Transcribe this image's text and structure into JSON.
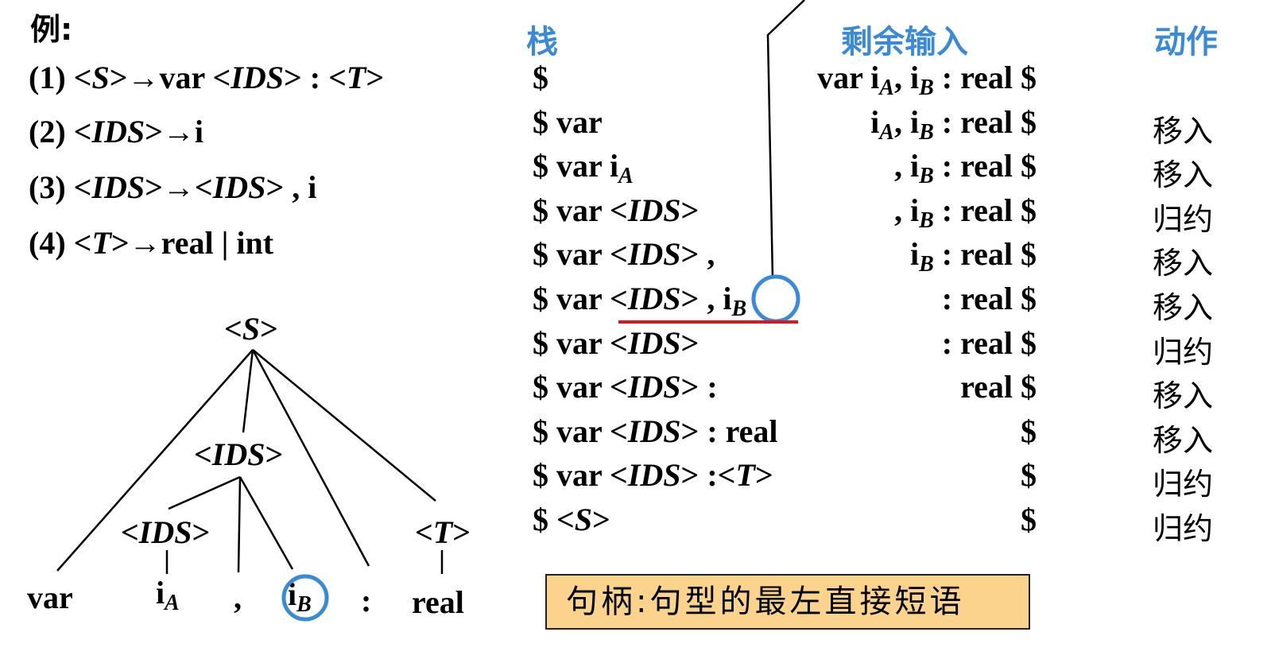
{
  "example_label": "例:",
  "productions": [
    {
      "num": "(1)",
      "segs": [
        [
          "t",
          "<"
        ],
        [
          "i",
          "S"
        ],
        [
          "t",
          ">→var <"
        ],
        [
          "i",
          "IDS"
        ],
        [
          "t",
          "> : <"
        ],
        [
          "i",
          "T"
        ],
        [
          "t",
          ">"
        ]
      ]
    },
    {
      "num": "(2)",
      "segs": [
        [
          "t",
          "<"
        ],
        [
          "i",
          "IDS"
        ],
        [
          "t",
          ">→i"
        ]
      ]
    },
    {
      "num": "(3)",
      "segs": [
        [
          "t",
          "<"
        ],
        [
          "i",
          "IDS"
        ],
        [
          "t",
          ">→<"
        ],
        [
          "i",
          "IDS"
        ],
        [
          "t",
          "> , i"
        ]
      ]
    },
    {
      "num": "(4)",
      "segs": [
        [
          "t",
          "<"
        ],
        [
          "i",
          "T"
        ],
        [
          "t",
          ">→real | int"
        ]
      ]
    }
  ],
  "table": {
    "headers": {
      "stack": "栈",
      "input": "剩余输入",
      "action": "动作"
    },
    "rows": [
      {
        "stack": [
          [
            "t",
            "$"
          ]
        ],
        "input": [
          [
            "t",
            "var i"
          ],
          [
            "s",
            "A"
          ],
          [
            "t",
            ", i"
          ],
          [
            "s",
            "B"
          ],
          [
            "t",
            " : real $"
          ]
        ],
        "action": ""
      },
      {
        "stack": [
          [
            "t",
            "$ var"
          ]
        ],
        "input": [
          [
            "t",
            "i"
          ],
          [
            "s",
            "A"
          ],
          [
            "t",
            ", i"
          ],
          [
            "s",
            "B"
          ],
          [
            "t",
            " : real $"
          ]
        ],
        "action": "移入"
      },
      {
        "stack": [
          [
            "t",
            "$ var i"
          ],
          [
            "s",
            "A"
          ]
        ],
        "input": [
          [
            "t",
            ", i"
          ],
          [
            "s",
            "B"
          ],
          [
            "t",
            " : real $"
          ]
        ],
        "action": "移入"
      },
      {
        "stack": [
          [
            "t",
            "$ var <"
          ],
          [
            "i",
            "IDS"
          ],
          [
            "t",
            ">"
          ]
        ],
        "input": [
          [
            "t",
            ", i"
          ],
          [
            "s",
            "B"
          ],
          [
            "t",
            " : real $"
          ]
        ],
        "action": "归约"
      },
      {
        "stack": [
          [
            "t",
            "$ var <"
          ],
          [
            "i",
            "IDS"
          ],
          [
            "t",
            "> ,"
          ]
        ],
        "input": [
          [
            "t",
            "i"
          ],
          [
            "s",
            "B"
          ],
          [
            "t",
            " : real $"
          ]
        ],
        "action": "移入"
      },
      {
        "stack": [
          [
            "t",
            "$ var <"
          ],
          [
            "i",
            "IDS"
          ],
          [
            "t",
            "> , i"
          ],
          [
            "s",
            "B"
          ]
        ],
        "input": [
          [
            "t",
            ": real $"
          ]
        ],
        "action": "移入"
      },
      {
        "stack": [
          [
            "t",
            "$ var <"
          ],
          [
            "i",
            "IDS"
          ],
          [
            "t",
            ">"
          ]
        ],
        "input": [
          [
            "t",
            ": real $"
          ]
        ],
        "action": "归约"
      },
      {
        "stack": [
          [
            "t",
            "$ var <"
          ],
          [
            "i",
            "IDS"
          ],
          [
            "t",
            "> :"
          ]
        ],
        "input": [
          [
            "t",
            "real $"
          ]
        ],
        "action": "移入"
      },
      {
        "stack": [
          [
            "t",
            "$ var <"
          ],
          [
            "i",
            "IDS"
          ],
          [
            "t",
            "> : real"
          ]
        ],
        "input": [
          [
            "t",
            "$"
          ]
        ],
        "action": "移入"
      },
      {
        "stack": [
          [
            "t",
            "$ var <"
          ],
          [
            "i",
            "IDS"
          ],
          [
            "t",
            "> :<"
          ],
          [
            "i",
            "T"
          ],
          [
            "t",
            ">"
          ]
        ],
        "input": [
          [
            "t",
            "$"
          ]
        ],
        "action": "归约"
      },
      {
        "stack": [
          [
            "t",
            "$ <"
          ],
          [
            "i",
            "S"
          ],
          [
            "t",
            ">"
          ]
        ],
        "input": [
          [
            "t",
            "$"
          ]
        ],
        "action": "归约"
      }
    ]
  },
  "tree": {
    "root": [
      [
        "t",
        "<"
      ],
      [
        "i",
        "S"
      ],
      [
        "t",
        ">"
      ]
    ],
    "ids_node": [
      [
        "t",
        "<"
      ],
      [
        "i",
        "IDS"
      ],
      [
        "t",
        ">"
      ]
    ],
    "ids_child": [
      [
        "t",
        "<"
      ],
      [
        "i",
        "IDS"
      ],
      [
        "t",
        ">"
      ]
    ],
    "t_node": [
      [
        "t",
        "<"
      ],
      [
        "i",
        "T"
      ],
      [
        "t",
        ">"
      ]
    ],
    "leaves": {
      "var": [
        [
          "t",
          "var"
        ]
      ],
      "ia": [
        [
          "t",
          "i"
        ],
        [
          "s",
          "A"
        ]
      ],
      "comma": [
        [
          "t",
          ","
        ]
      ],
      "ib": [
        [
          "t",
          "i"
        ],
        [
          "s",
          "B"
        ]
      ],
      "colon": [
        [
          "t",
          ":"
        ]
      ],
      "real": [
        [
          "t",
          "real"
        ]
      ]
    }
  },
  "callout_text": "句柄:句型的最左直接短语",
  "colors": {
    "header": "#3a8ad6",
    "highlight_circle": "#3a8ad6",
    "underline": "#e0141e",
    "callout_bg": "#fbd38d"
  }
}
